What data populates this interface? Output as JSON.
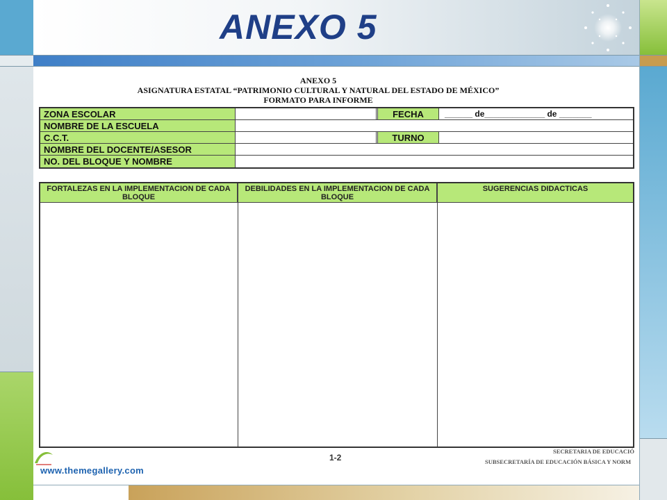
{
  "slide": {
    "title": "ANEXO 5",
    "website": "www.themegallery.com"
  },
  "document": {
    "heading_line1": "ANEXO 5",
    "heading_line2": "ASIGNATURA ESTATAL “PATRIMONIO CULTURAL Y NATURAL DEL ESTADO DE MÉXICO”",
    "heading_line3": "FORMATO PARA INFORME",
    "form_fields": [
      {
        "label": "ZONA ESCOLAR"
      },
      {
        "label": "NOMBRE DE LA ESCUELA"
      },
      {
        "label": "C.C.T."
      },
      {
        "label": "NOMBRE DEL DOCENTE/ASESOR"
      },
      {
        "label": "NO. DEL BLOQUE Y NOMBRE"
      }
    ],
    "fecha_label": "FECHA",
    "fecha_line": "______ de_____________ de _______",
    "turno_label": "TURNO",
    "columns": [
      {
        "header": "FORTALEZAS  EN LA IMPLEMENTACION DE CADA BLOQUE"
      },
      {
        "header": "DEBILIDADES  EN LA IMPLEMENTACION DE CADA BLOQUE"
      },
      {
        "header": "SUGERENCIAS DIDACTICAS"
      }
    ],
    "page_number": "1-2",
    "footer_line1": "SECRETARIA DE EDUCACIÓ",
    "footer_line2": "SUBSECRETARÍA DE EDUCACIÓN BÁSICA Y NORM"
  },
  "colors": {
    "title_blue": "#1f3f87",
    "form_green": "#b7e879",
    "link_blue": "#1e63b0"
  },
  "icons": {
    "sparkle": "sparkle-star-icon",
    "logo": "green-swoosh-icon"
  }
}
